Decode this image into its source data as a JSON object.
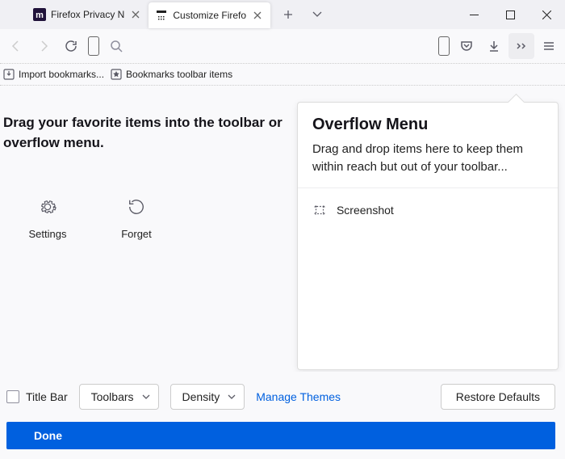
{
  "tabs": {
    "tab0": {
      "label": "Firefox Privacy N"
    },
    "tab1": {
      "label": "Customize Firefo"
    }
  },
  "bookmarks": {
    "import": "Import bookmarks...",
    "items": "Bookmarks toolbar items"
  },
  "customize": {
    "instruction": "Drag your favorite items into the toolbar or overflow menu.",
    "grid": {
      "settings": "Settings",
      "forget": "Forget"
    }
  },
  "overflow": {
    "title": "Overflow Menu",
    "desc": "Drag and drop items here to keep them within reach but out of your toolbar...",
    "items": {
      "screenshot": "Screenshot"
    }
  },
  "bottom": {
    "titlebar": "Title Bar",
    "toolbars": "Toolbars",
    "density": "Density",
    "themes": "Manage Themes",
    "restore": "Restore Defaults",
    "done": "Done"
  }
}
